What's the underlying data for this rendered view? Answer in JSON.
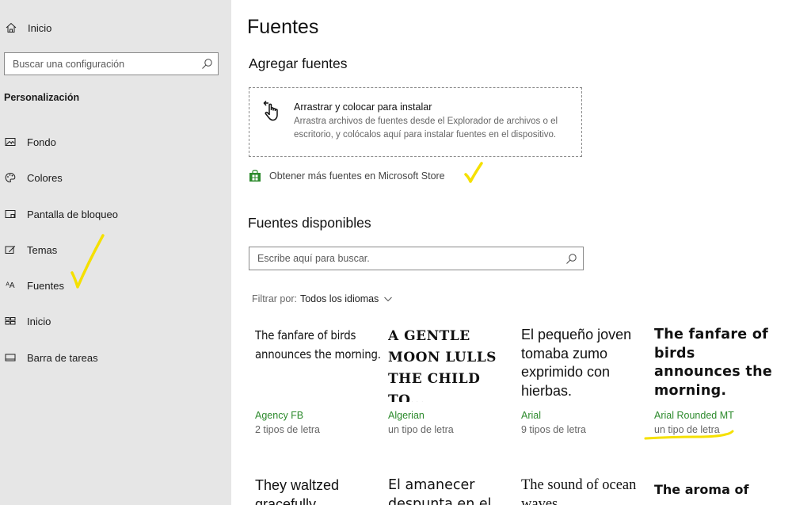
{
  "sidebar": {
    "home_label": "Inicio",
    "search_placeholder": "Buscar una configuración",
    "section_title": "Personalización",
    "items": [
      {
        "label": "Fondo",
        "icon": "image-icon"
      },
      {
        "label": "Colores",
        "icon": "palette-icon"
      },
      {
        "label": "Pantalla de bloqueo",
        "icon": "lock-screen-icon"
      },
      {
        "label": "Temas",
        "icon": "themes-icon"
      },
      {
        "label": "Fuentes",
        "icon": "fonts-icon"
      },
      {
        "label": "Inicio",
        "icon": "start-icon"
      },
      {
        "label": "Barra de tareas",
        "icon": "taskbar-icon"
      }
    ]
  },
  "main": {
    "title": "Fuentes",
    "add_fonts_title": "Agregar fuentes",
    "drop_zone": {
      "title": "Arrastrar y colocar para instalar",
      "description": "Arrastra archivos de fuentes desde el Explorador de archivos o el escritorio, y colócalos aquí para instalar fuentes en el dispositivo."
    },
    "store_link": "Obtener más fuentes en Microsoft Store",
    "available_title": "Fuentes disponibles",
    "search_placeholder": "Escribe aquí para buscar.",
    "filter_label": "Filtrar por:",
    "filter_value": "Todos los idiomas",
    "fonts": [
      {
        "preview": "The fanfare of birds announces the morning.",
        "name": "Agency FB",
        "count": "2 tipos de letra"
      },
      {
        "preview": "A GENTLE MOON LULLS THE CHILD TO...",
        "name": "Algerian",
        "count": "un tipo de letra"
      },
      {
        "preview": "El pequeño joven tomaba zumo exprimido con hierbas.",
        "name": "Arial",
        "count": "9 tipos de letra"
      },
      {
        "preview": "The fanfare of birds announces the morning.",
        "name": "Arial Rounded MT",
        "count": "un tipo de letra"
      }
    ],
    "fonts_row2": [
      {
        "preview": "They waltzed gracefully"
      },
      {
        "preview": "El amanecer despunta en el"
      },
      {
        "preview": "The sound of ocean waves"
      },
      {
        "preview": "The aroma of"
      }
    ]
  },
  "colors": {
    "sidebar_bg": "#e6e6e6",
    "accent_green": "#2c8a2c",
    "annotation_yellow": "#f5e000"
  }
}
